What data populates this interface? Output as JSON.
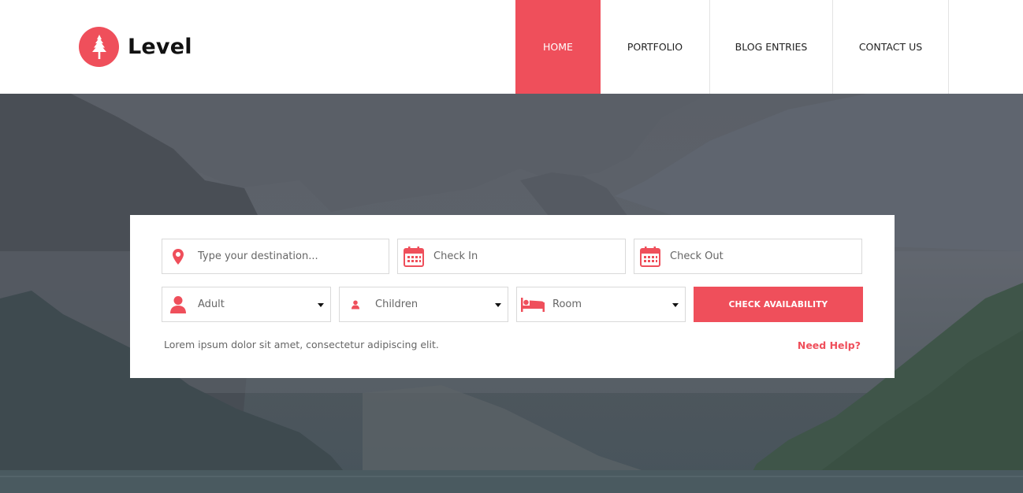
{
  "brand": {
    "name": "Level",
    "accent": "#ef4f5b",
    "logo_icon": "pine-tree-icon"
  },
  "nav": {
    "items": [
      {
        "label": "HOME",
        "active": true
      },
      {
        "label": "PORTFOLIO",
        "active": false
      },
      {
        "label": "BLOG ENTRIES",
        "active": false
      },
      {
        "label": "CONTACT US",
        "active": false
      }
    ]
  },
  "search": {
    "destination": {
      "placeholder": "Type your destination...",
      "icon": "map-pin-icon"
    },
    "check_in": {
      "placeholder": "Check In",
      "icon": "calendar-icon"
    },
    "check_out": {
      "placeholder": "Check Out",
      "icon": "calendar-icon"
    },
    "adult": {
      "value": "Adult",
      "icon": "user-icon"
    },
    "children": {
      "value": "Children",
      "icon": "user-small-icon"
    },
    "room": {
      "value": "Room",
      "icon": "bed-icon"
    },
    "submit_label": "CHECK AVAILABILITY",
    "note": "Lorem ipsum dolor sit amet, consectetur adipiscing elit.",
    "help_label": "Need Help?"
  }
}
